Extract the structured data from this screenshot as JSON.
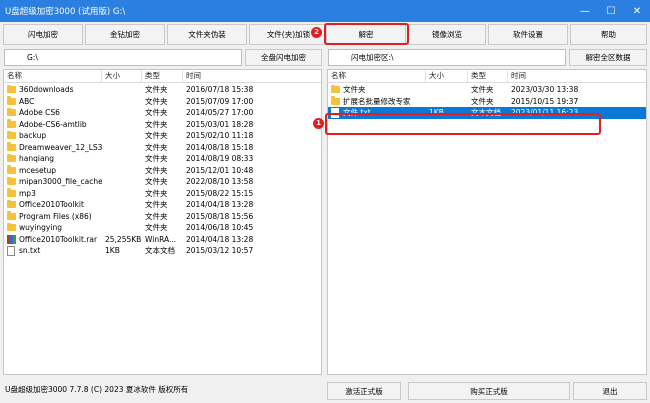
{
  "window": {
    "title": "U盘超级加密3000 (试用版)   G:\\",
    "minimize_glyph": "—",
    "maximize_glyph": "☐",
    "close_glyph": "✕"
  },
  "toolbar": {
    "buttons": [
      "闪电加密",
      "金钻加密",
      "文件夹伪装",
      "文件(夹)加锁",
      "解密",
      "镜像浏览",
      "软件设置",
      "帮助"
    ]
  },
  "left": {
    "path": "G:\\",
    "action_button": "全盘闪电加密",
    "columns": [
      "名称",
      "大小",
      "类型",
      "时间"
    ],
    "rows": [
      {
        "name": "360downloads",
        "size": "",
        "type": "文件夹",
        "time": "2016/07/18 15:38",
        "icon": "folder"
      },
      {
        "name": "ABC",
        "size": "",
        "type": "文件夹",
        "time": "2015/07/09 17:00",
        "icon": "folder"
      },
      {
        "name": "Adobe CS6",
        "size": "",
        "type": "文件夹",
        "time": "2014/05/27 17:00",
        "icon": "folder"
      },
      {
        "name": "Adobe-CS6-amtlib",
        "size": "",
        "type": "文件夹",
        "time": "2015/03/01 18:28",
        "icon": "folder"
      },
      {
        "name": "backup",
        "size": "",
        "type": "文件夹",
        "time": "2015/02/10 11:18",
        "icon": "folder"
      },
      {
        "name": "Dreamweaver_12_LS3",
        "size": "",
        "type": "文件夹",
        "time": "2014/08/18 15:18",
        "icon": "folder"
      },
      {
        "name": "hanqiang",
        "size": "",
        "type": "文件夹",
        "time": "2014/08/19 08:33",
        "icon": "folder"
      },
      {
        "name": "mcesetup",
        "size": "",
        "type": "文件夹",
        "time": "2015/12/01 10:48",
        "icon": "folder"
      },
      {
        "name": "mipan3000_file_cache",
        "size": "",
        "type": "文件夹",
        "time": "2022/08/10 13:58",
        "icon": "folder"
      },
      {
        "name": "mp3",
        "size": "",
        "type": "文件夹",
        "time": "2015/08/22 15:15",
        "icon": "folder"
      },
      {
        "name": "Office2010Toolkit",
        "size": "",
        "type": "文件夹",
        "time": "2014/04/18 13:28",
        "icon": "folder"
      },
      {
        "name": "Program Files (x86)",
        "size": "",
        "type": "文件夹",
        "time": "2015/08/18 15:56",
        "icon": "folder"
      },
      {
        "name": "wuyingying",
        "size": "",
        "type": "文件夹",
        "time": "2014/06/18 10:45",
        "icon": "folder"
      },
      {
        "name": "Office2010Toolkit.rar",
        "size": "25,255KB",
        "type": "WinRA...",
        "time": "2014/04/18 13:28",
        "icon": "rar"
      },
      {
        "name": "sn.txt",
        "size": "1KB",
        "type": "文本文档",
        "time": "2015/03/12 10:57",
        "icon": "doc"
      }
    ]
  },
  "right": {
    "path": "闪电加密区:\\",
    "action_button": "解密全区数据",
    "columns": [
      "名称",
      "大小",
      "类型",
      "时间"
    ],
    "rows": [
      {
        "name": "文件夹",
        "size": "",
        "type": "文件夹",
        "time": "2023/03/30 13:38",
        "icon": "folder"
      },
      {
        "name": "扩展名批量修改专家",
        "size": "",
        "type": "文件夹",
        "time": "2015/10/15 19:37",
        "icon": "folder"
      },
      {
        "name": "文件.txt",
        "size": "1KB",
        "type": "文本文档",
        "time": "2023/01/11 16:23",
        "icon": "doc",
        "selected": true
      }
    ]
  },
  "status": {
    "text": "U盘超级加密3000 7.7.8 (C) 2023 夏冰软件 版权所有"
  },
  "bottom_buttons": [
    "激活正式版",
    "购买正式版",
    "退出"
  ],
  "annotations": {
    "badge1": "1",
    "badge2": "2",
    "color": "#e02020"
  }
}
